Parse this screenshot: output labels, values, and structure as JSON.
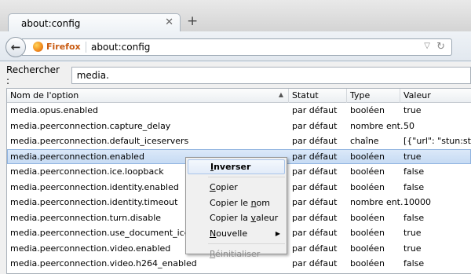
{
  "tab": {
    "title": "about:config",
    "close_glyph": "✕",
    "new_tab_glyph": "+"
  },
  "navbar": {
    "back_glyph": "←",
    "identity_label": "Firefox",
    "url": "about:config",
    "dropdown_glyph": "▽",
    "reload_glyph": "↻"
  },
  "search": {
    "label": "Rechercher :",
    "value": "media."
  },
  "table": {
    "columns": [
      "Nom de l'option",
      "Statut",
      "Type",
      "Valeur"
    ],
    "sort_glyph": "▲",
    "rows": [
      {
        "name": "media.opus.enabled",
        "status": "par défaut",
        "type": "booléen",
        "value": "true"
      },
      {
        "name": "media.peerconnection.capture_delay",
        "status": "par défaut",
        "type": "nombre ent...",
        "value": "50"
      },
      {
        "name": "media.peerconnection.default_iceservers",
        "status": "par défaut",
        "type": "chaîne",
        "value": "[{\"url\": \"stun:stun.se"
      },
      {
        "name": "media.peerconnection.enabled",
        "status": "par défaut",
        "type": "booléen",
        "value": "true"
      },
      {
        "name": "media.peerconnection.ice.loopback",
        "status": "par défaut",
        "type": "booléen",
        "value": "false"
      },
      {
        "name": "media.peerconnection.identity.enabled",
        "status": "par défaut",
        "type": "booléen",
        "value": "false"
      },
      {
        "name": "media.peerconnection.identity.timeout",
        "status": "par défaut",
        "type": "nombre ent...",
        "value": "10000"
      },
      {
        "name": "media.peerconnection.turn.disable",
        "status": "par défaut",
        "type": "booléen",
        "value": "false"
      },
      {
        "name": "media.peerconnection.use_document_iceservers",
        "status": "par défaut",
        "type": "booléen",
        "value": "true"
      },
      {
        "name": "media.peerconnection.video.enabled",
        "status": "par défaut",
        "type": "booléen",
        "value": "true"
      },
      {
        "name": "media.peerconnection.video.h264_enabled",
        "status": "par défaut",
        "type": "booléen",
        "value": "false"
      }
    ]
  },
  "context_menu": {
    "inverser": {
      "pre": "",
      "key": "I",
      "post": "nverser"
    },
    "copier": {
      "pre": "",
      "key": "C",
      "post": "opier"
    },
    "copier_nom": {
      "pre": "Copier le ",
      "key": "n",
      "post": "om"
    },
    "copier_valeur": {
      "pre": "Copier la ",
      "key": "v",
      "post": "aleur"
    },
    "nouvelle": {
      "pre": "",
      "key": "N",
      "post": "ouvelle"
    },
    "nouvelle_arrow": "▶",
    "reinitialiser": {
      "pre": "",
      "key": "R",
      "post": "éinitialiser"
    }
  }
}
